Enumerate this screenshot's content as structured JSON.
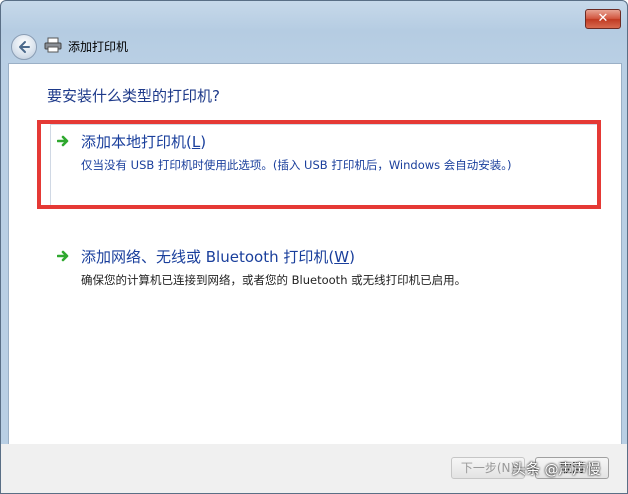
{
  "window": {
    "title": "添加打印机",
    "close_label": "✕"
  },
  "heading": "要安装什么类型的打印机?",
  "options": [
    {
      "title": "添加本地打印机(",
      "accel": "L",
      "title_end": ")",
      "description": "仅当没有 USB 打印机时使用此选项。(插入 USB 打印机后，Windows 会自动安装。)"
    },
    {
      "title": "添加网络、无线或 Bluetooth 打印机(",
      "accel": "W",
      "title_end": ")",
      "description": "确保您的计算机已连接到网络，或者您的 Bluetooth 或无线打印机已启用。"
    }
  ],
  "footer": {
    "next_label": "下一步(N)",
    "cancel_label": "取消"
  },
  "watermark": "头条 @声声慢",
  "colors": {
    "highlight": "#e53935",
    "link_blue": "#1a3f9c",
    "arrow_green": "#2fa82f"
  }
}
